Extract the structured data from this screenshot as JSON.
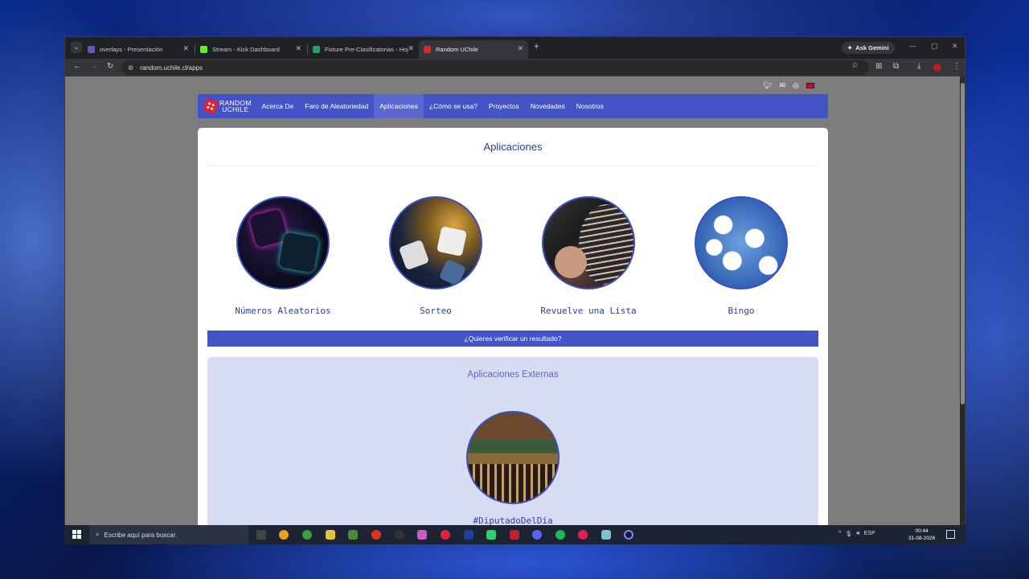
{
  "browser": {
    "tabs": [
      {
        "title": "overlays - Presentación",
        "color": "#5b57d6"
      },
      {
        "title": "Stream - Kick Dashboard",
        "color": "#53fc18"
      },
      {
        "title": "Fixture Pre-Clasificatorias - Hoj",
        "color": "#1fa463"
      },
      {
        "title": "Random UChile",
        "color": "#e4222f"
      }
    ],
    "active_tab": 3,
    "ask_gemini": "Ask Gemini",
    "url": "random.uchile.cl/apps"
  },
  "site": {
    "logo_line1": "RANDOM",
    "logo_line2": "UCHILE",
    "nav": [
      "Acerca De",
      "Faro de Aleatoriedad",
      "Aplicaciones",
      "¿Cómo se usa?",
      "Proyectos",
      "Novedades",
      "Nosotros"
    ],
    "active_nav": "Aplicaciones",
    "social_icons": [
      "twitter-icon",
      "mail-icon",
      "rss-icon",
      "uk-flag-icon"
    ]
  },
  "main": {
    "title": "Aplicaciones",
    "apps": [
      {
        "name": "Números Aleatorios",
        "image": "dice-neon-image"
      },
      {
        "name": "Sorteo",
        "image": "dice-pile-image"
      },
      {
        "name": "Revuelve una Lista",
        "image": "poker-chips-image"
      },
      {
        "name": "Bingo",
        "image": "bingo-balls-image"
      }
    ],
    "verify_button": "¿Quieres verificar un resultado?",
    "external": {
      "title": "Aplicaciones Externas",
      "apps": [
        {
          "name": "#DiputadoDelDía",
          "image": "congress-chamber-image"
        }
      ]
    }
  },
  "taskbar": {
    "search_placeholder": "Escribe aquí para buscar.",
    "language": "ESP",
    "time": "00:44",
    "date": "31-08-2026"
  },
  "colors": {
    "accent": "#4354c6",
    "title_text": "#2e3d9c",
    "external_bg": "#d8dcf2"
  }
}
